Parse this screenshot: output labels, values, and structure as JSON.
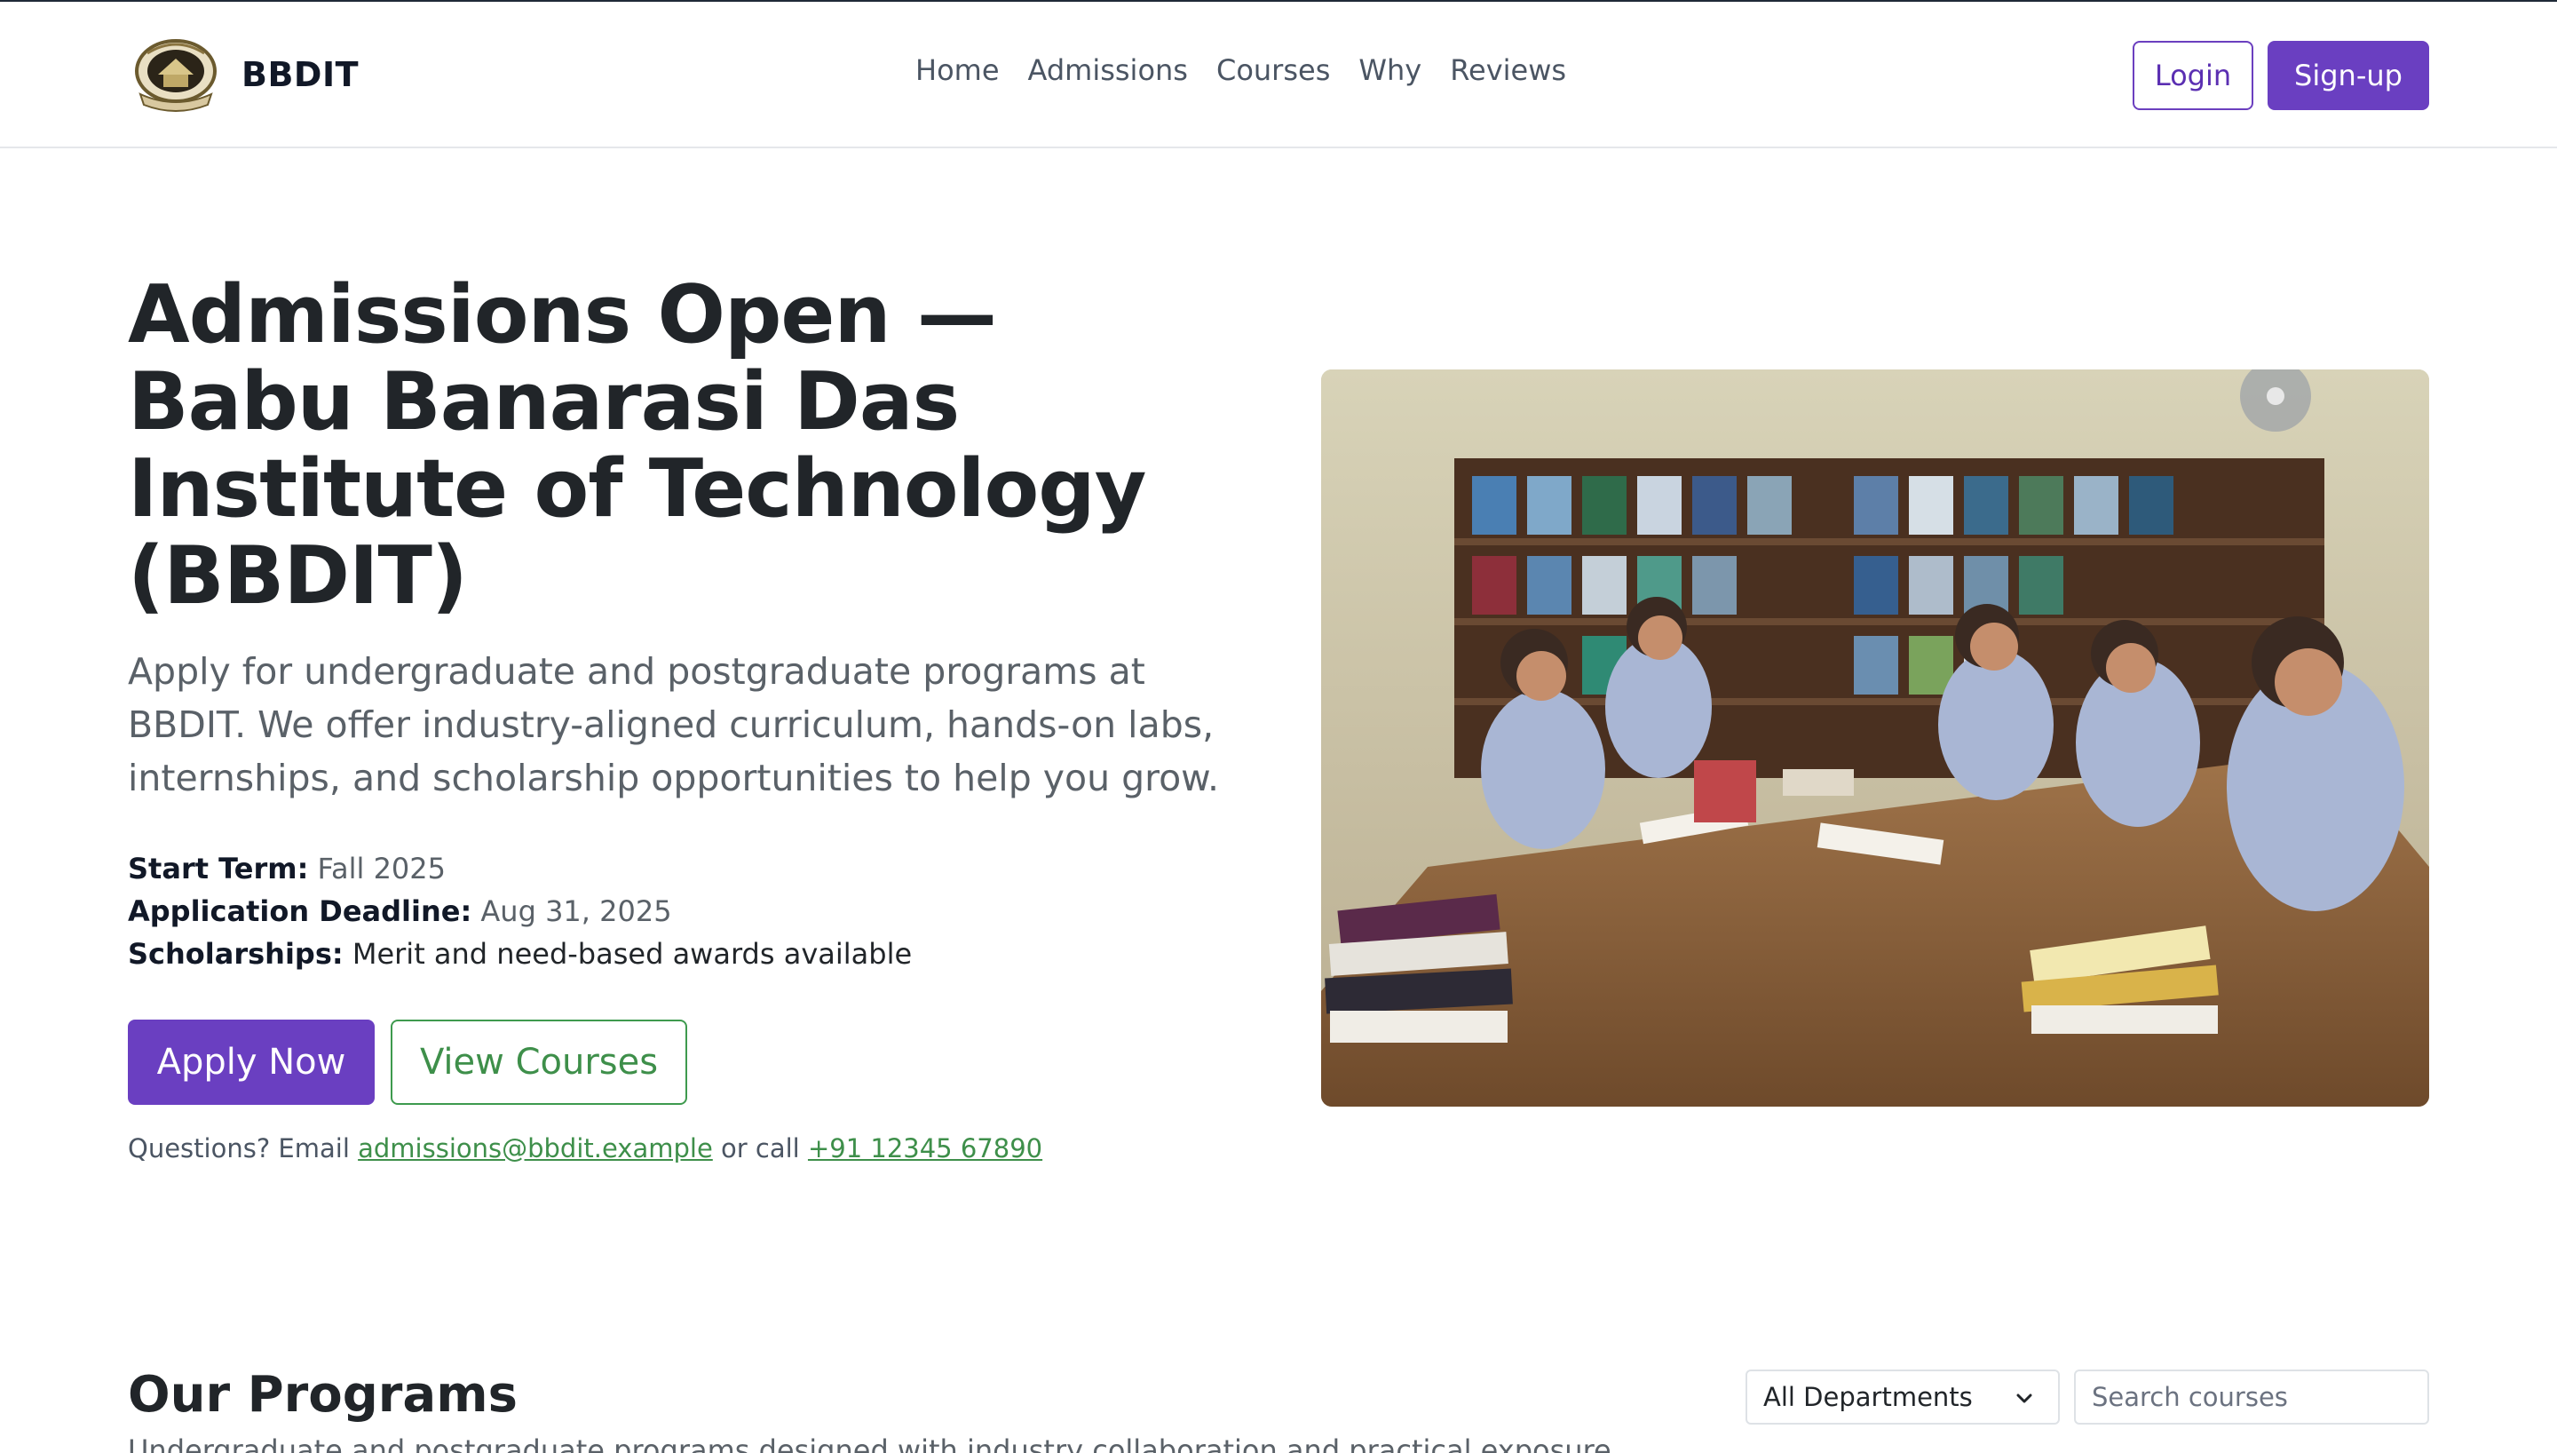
{
  "brand": {
    "name": "BBDIT",
    "logo_icon": "college-crest-logo"
  },
  "nav": {
    "links": [
      "Home",
      "Admissions",
      "Courses",
      "Why",
      "Reviews"
    ],
    "login_label": "Login",
    "signup_label": "Sign-up"
  },
  "hero": {
    "title": "Admissions Open — Babu Banarasi Das Institute of Technology (BBDIT)",
    "lead": "Apply for undergraduate and postgraduate programs at BBDIT. We offer industry-aligned curriculum, hands-on labs, internships, and scholarship opportunities to help you grow.",
    "facts": [
      {
        "label": "Start Term:",
        "value": "Fall 2025"
      },
      {
        "label": "Application Deadline:",
        "value": "Aug 31, 2025"
      },
      {
        "label": "Scholarships:",
        "value": "Merit and need-based awards available"
      }
    ],
    "apply_label": "Apply Now",
    "view_courses_label": "View Courses",
    "contact": {
      "prefix": "Questions? Email",
      "email": "admissions@bbdit.example",
      "middle": "or call",
      "phone": "+91 12345 67890"
    }
  },
  "programs": {
    "title": "Our Programs",
    "subtitle": "Undergraduate and postgraduate programs designed with industry collaboration and practical exposure",
    "department_selected": "All Departments",
    "search_placeholder": "Search courses"
  },
  "colors": {
    "primary": "#6a3fc1",
    "success": "#3e8f4a",
    "text": "#212529",
    "muted": "#5a6168"
  }
}
